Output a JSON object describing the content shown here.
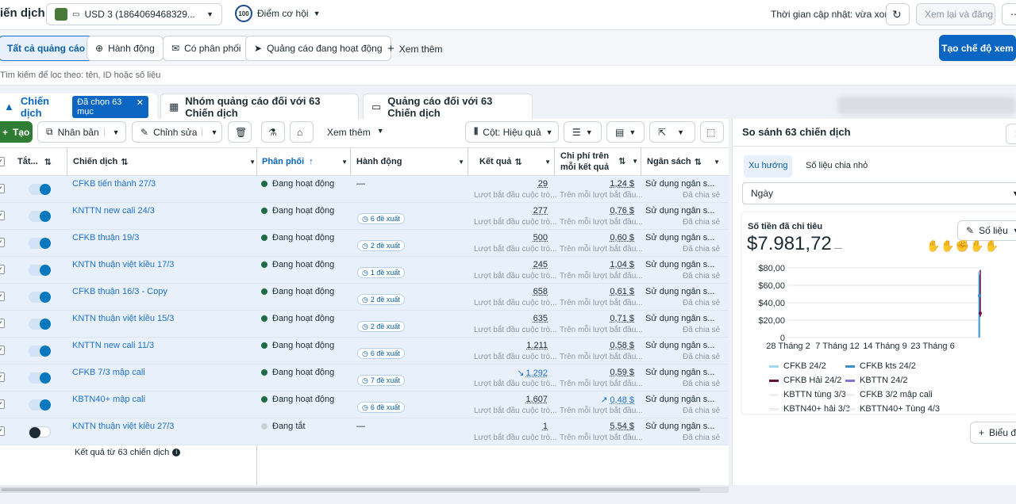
{
  "topbar": {
    "title": "iến dịch",
    "account": "USD 3 (1864069468329...",
    "opportunity_score": "100",
    "opportunity_label": "Điểm cơ hội",
    "updated_label": "Thời gian cập nhật: vừa xong",
    "review_label": "Xem lại và đăng"
  },
  "filters": {
    "all_ads": "Tất cả quảng cáo",
    "action": "Hành động",
    "delivered": "Có phân phối",
    "active_ads": "Quảng cáo đang hoạt động",
    "more": "Xem thêm",
    "create_view": "Tạo chế độ xem"
  },
  "search": {
    "placeholder": "Tìm kiếm để lọc theo: tên, ID hoặc số liệu"
  },
  "tabs": {
    "campaigns": "Chiến dịch",
    "selected": "Đã chọn 63 mục",
    "adsets": "Nhóm quảng cáo đối với 63 Chiến dịch",
    "ads": "Quảng cáo đối với 63 Chiến dịch"
  },
  "toolbar": {
    "create": "Tạo",
    "duplicate": "Nhân bản",
    "edit": "Chỉnh sửa",
    "more": "Xem thêm",
    "columns": "Cột: Hiệu quả"
  },
  "columns": {
    "onoff": "Tắt...",
    "campaign": "Chiến dịch",
    "delivery": "Phân phối",
    "action": "Hành động",
    "results": "Kết quả",
    "cpr_line1": "Chi phí trên",
    "cpr_line2": "mỗi kết quả",
    "budget": "Ngân sách"
  },
  "rows": [
    {
      "name": "CFKB tiến thành 27/3",
      "on": true,
      "status": "Đang hoạt động",
      "action": "—",
      "result": "29",
      "cpr": "1,24 $"
    },
    {
      "name": "KNTTN new cali 24/3",
      "on": true,
      "status": "Đang hoạt động",
      "action": "6 đề xuất",
      "result": "277",
      "cpr": "0,76 $"
    },
    {
      "name": "CFKB thuận 19/3",
      "on": true,
      "status": "Đang hoạt động",
      "action": "2 đề xuất",
      "result": "500",
      "cpr": "0,60 $"
    },
    {
      "name": "KNTN thuận việt kiều 17/3",
      "on": true,
      "status": "Đang hoạt động",
      "action": "1 đề xuất",
      "result": "245",
      "cpr": "1,04 $"
    },
    {
      "name": "CFKB thuận 16/3 - Copy",
      "on": true,
      "status": "Đang hoạt động",
      "action": "2 đề xuất",
      "result": "658",
      "cpr": "0,61 $"
    },
    {
      "name": "KNTN thuận việt kiều 15/3",
      "on": true,
      "status": "Đang hoạt động",
      "action": "2 đề xuất",
      "result": "635",
      "cpr": "0,71 $"
    },
    {
      "name": "KNTTN new cali 11/3",
      "on": true,
      "status": "Đang hoạt động",
      "action": "6 đề xuất",
      "result": "1.211",
      "cpr": "0,58 $"
    },
    {
      "name": "CFKB 7/3 mập cali",
      "on": true,
      "status": "Đang hoạt động",
      "action": "7 đề xuất",
      "result": "1.292",
      "cpr": "0,59 $"
    },
    {
      "name": "KBTN40+ mập cali",
      "on": true,
      "status": "Đang hoạt động",
      "action": "6 đề xuất",
      "result": "1.607",
      "cpr": "0,48 $"
    },
    {
      "name": "KNTN thuận việt kiều 27/3",
      "on": false,
      "status": "Đang tắt",
      "action": "—",
      "result": "1",
      "cpr": "5,54 $"
    }
  ],
  "row_sub": {
    "result": "Lượt bắt đầu cuộc trò...",
    "cpr": "Trên mỗi lượt bắt đầu...",
    "budget": "Sử dụng ngân s...",
    "budget_sub": "Đã chia sẻ"
  },
  "footer": {
    "label": "Kết quả từ 63 chiến dịch"
  },
  "panel": {
    "title": "So sánh 63 chiến dịch",
    "tab_trend": "Xu hướng",
    "tab_breakdown": "Số liệu chia nhỏ",
    "period": "Ngày",
    "metric_label": "Số tiền đã chi tiêu",
    "metric_value": "$7.981,72",
    "metric_button": "Số liệu",
    "chart_button": "Biểu đ"
  },
  "chart_data": {
    "type": "line",
    "y_ticks": [
      "$80,00",
      "$60,00",
      "$40,00",
      "$20,00",
      "0"
    ],
    "x_ticks": [
      "28 Tháng 2",
      "7 Tháng 12",
      "14 Tháng 9",
      "23 Tháng 6"
    ],
    "ylim": [
      0,
      80
    ],
    "legend": [
      {
        "name": "CFKB 24/2",
        "color": "#a8d8f0"
      },
      {
        "name": "CFKB kts 24/2",
        "color": "#3a8fc4"
      },
      {
        "name": "CFKB Hải 24/2",
        "color": "#6b1140"
      },
      {
        "name": "KBTTN 24/2",
        "color": "#8a72d0"
      },
      {
        "name": "KBTTN tùng 3/3",
        "color": "#eeeeee"
      },
      {
        "name": "CFKB 3/2 mập cali",
        "color": "#eeeeee"
      },
      {
        "name": "KBTN40+ hải 3/3",
        "color": "#eeeeee"
      },
      {
        "name": "KBTTN40+ Tùng 4/3",
        "color": "#eeeeee"
      }
    ]
  }
}
